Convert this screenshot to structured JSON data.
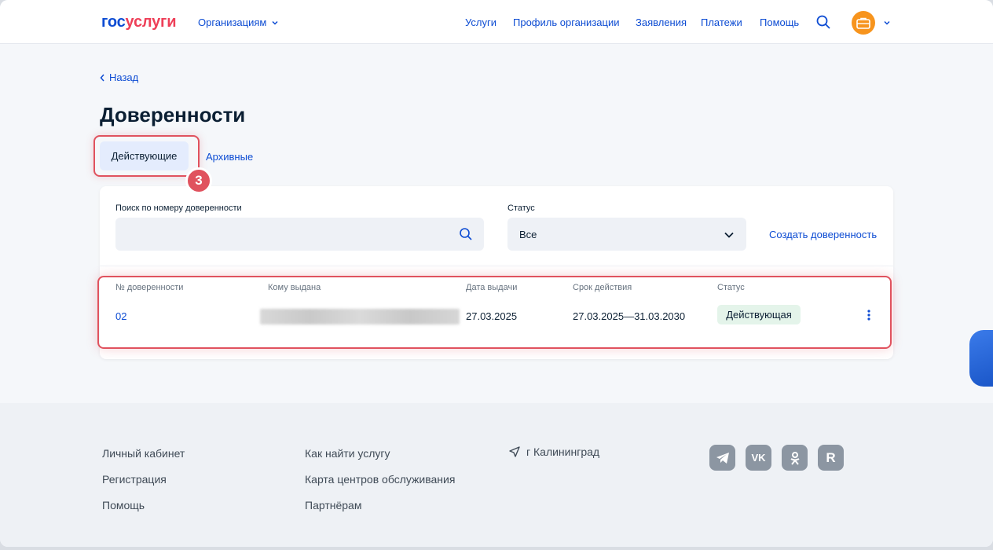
{
  "header": {
    "logo_part1": "гос",
    "logo_part2": "услуги",
    "org_menu_label": "Организациям",
    "nav": [
      "Услуги",
      "Профиль организации",
      "Заявления",
      "Платежи",
      "Помощь"
    ]
  },
  "page": {
    "back_label": "Назад",
    "title": "Доверенности",
    "tabs": [
      {
        "label": "Действующие",
        "active": true
      },
      {
        "label": "Архивные",
        "active": false
      }
    ],
    "step_number": "3"
  },
  "filters": {
    "search_label": "Поиск по номеру доверенности",
    "search_value": "",
    "status_label": "Статус",
    "status_value": "Все",
    "create_label": "Создать доверенность"
  },
  "table": {
    "columns": [
      "№ доверенности",
      "Кому выдана",
      "Дата выдачи",
      "Срок действия",
      "Статус"
    ],
    "rows": [
      {
        "number": "02",
        "issued_to": "",
        "issue_date": "27.03.2025",
        "validity": "27.03.2025—31.03.2030",
        "status": "Действующая"
      }
    ]
  },
  "footer": {
    "col1": [
      "Личный кабинет",
      "Регистрация",
      "Помощь"
    ],
    "col2": [
      "Как найти услугу",
      "Карта центров обслуживания",
      "Партнёрам"
    ],
    "city": "г Калининград",
    "social": [
      "telegram-icon",
      "vk-icon",
      "ok-icon",
      "rutube-icon"
    ]
  },
  "colors": {
    "primary": "#0d4cd3",
    "accent_red": "#ee3f58",
    "highlight": "#e0525e",
    "active_badge": "#e4f4ea",
    "avatar": "#f7941d"
  }
}
